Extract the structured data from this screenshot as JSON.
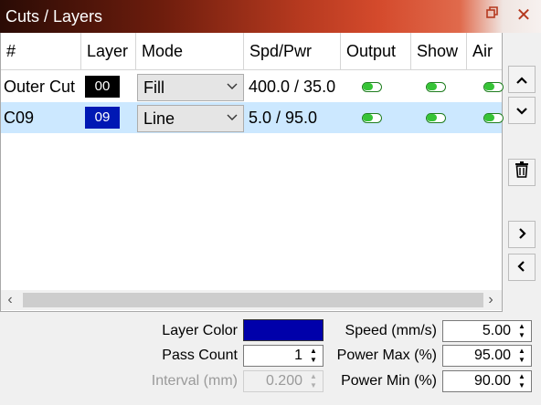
{
  "window": {
    "title": "Cuts / Layers",
    "restore_icon": "restore-icon",
    "close_glyph": "✕"
  },
  "table": {
    "headers": [
      "#",
      "Layer",
      "Mode",
      "Spd/Pwr",
      "Output",
      "Show",
      "Air"
    ],
    "rows": [
      {
        "name": "Outer Cut",
        "layer": "00",
        "layer_color": "#000000",
        "mode": "Fill",
        "spd_pwr": "400.0 / 35.0",
        "output": true,
        "show": true,
        "air": true,
        "selected": false
      },
      {
        "name": "C09",
        "layer": "09",
        "layer_color": "#0018b4",
        "mode": "Line",
        "spd_pwr": "5.0 / 95.0",
        "output": true,
        "show": true,
        "air": true,
        "selected": true
      }
    ]
  },
  "side_buttons": {
    "up": "▲",
    "down": "▼",
    "delete": "trash-icon",
    "right": "›",
    "left": "‹"
  },
  "scroll": {
    "left": "‹",
    "right": "›"
  },
  "settings": {
    "layer_color_label": "Layer Color",
    "layer_color": "#0000aa",
    "pass_count_label": "Pass Count",
    "pass_count": "1",
    "interval_label": "Interval (mm)",
    "interval": "0.200",
    "speed_label": "Speed (mm/s)",
    "speed": "5.00",
    "power_max_label": "Power Max (%)",
    "power_max": "95.00",
    "power_min_label": "Power Min (%)",
    "power_min": "90.00"
  },
  "colors": {
    "selection": "#cce8ff",
    "toggle_on": "#36c436",
    "toggle_border": "#1e7d1e"
  }
}
